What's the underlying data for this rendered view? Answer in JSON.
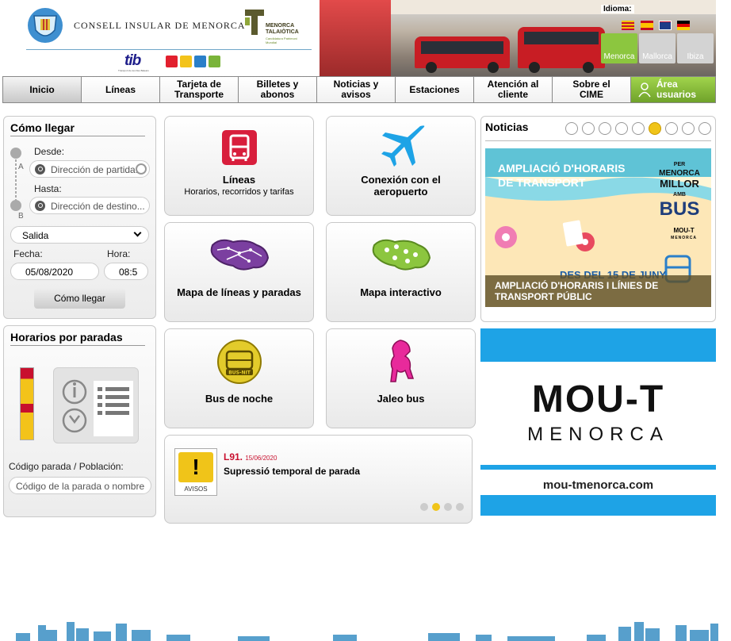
{
  "header": {
    "consell_name": "CONSELL INSULAR DE MENORCA",
    "talaiotica_line1": "MENORCA",
    "talaiotica_line2": "TALAIÒTICA",
    "talaiotica_tagline": "Candidatura Patrimoni Mundial",
    "tib_logo": "tib",
    "tib_tagline": "Transport de les Illes Balears",
    "language_label": "Idioma:",
    "flags": [
      "catalan-flag",
      "spanish-flag",
      "uk-flag",
      "german-flag"
    ],
    "islands": [
      {
        "label": "Menorca",
        "active": true
      },
      {
        "label": "Mallorca",
        "active": false
      },
      {
        "label": "Ibiza",
        "active": false
      }
    ]
  },
  "nav": {
    "items": [
      {
        "label": "Inicio"
      },
      {
        "label": "Líneas"
      },
      {
        "label": "Tarjeta de Transporte"
      },
      {
        "label": "Billetes y abonos"
      },
      {
        "label": "Noticias y avisos"
      },
      {
        "label": "Estaciones"
      },
      {
        "label": "Atención al cliente"
      },
      {
        "label": "Sobre el CIME"
      },
      {
        "label": "Área usuarios"
      }
    ]
  },
  "como_llegar": {
    "title": "Cómo llegar",
    "from_label": "Desde:",
    "from_placeholder": "Dirección de partida...",
    "to_label": "Hasta:",
    "to_placeholder": "Dirección de destino...",
    "marker_a": "A",
    "marker_b": "B",
    "mode_value": "Salida",
    "date_label": "Fecha:",
    "date_value": "05/08/2020",
    "time_label": "Hora:",
    "time_value": "08:5",
    "submit_label": "Cómo llegar"
  },
  "horarios": {
    "title": "Horarios por paradas",
    "stop_label": "Código parada / Población:",
    "stop_placeholder": "Código de la parada o nombre"
  },
  "tiles": {
    "lineas": {
      "title": "Líneas",
      "subtitle": "Horarios, recorridos y tarifas"
    },
    "aeropuerto": {
      "title": "Conexión con el aeropuerto"
    },
    "mapa_lineas": {
      "title": "Mapa de líneas y paradas"
    },
    "mapa_interactivo": {
      "title": "Mapa interactivo"
    },
    "bus_noche": {
      "title": "Bus de noche",
      "badge": "BUS-NIT"
    },
    "jaleo": {
      "title": "Jaleo bus"
    }
  },
  "avisos": {
    "icon_label": "AVISOS",
    "line": "L91.",
    "date": "15/06/2020",
    "text": "Supressió temporal de parada",
    "pages": 4,
    "active_page": 2
  },
  "noticias": {
    "title": "Noticias",
    "dots": 9,
    "active_dot": 6,
    "banner_title_line1": "AMPLIACIÓ D'HORARIS",
    "banner_title_line2": "DE TRANSPORT",
    "banner_slogan_1": "PER",
    "banner_slogan_2": "MENORCA",
    "banner_slogan_3": "MILLOR",
    "banner_slogan_4": "AMB",
    "banner_slogan_5": "BUS",
    "banner_mini_logo": "MOU-T",
    "banner_mini_logo_sub": "MENORCA",
    "banner_partial": "DES DEL 15 DE JUNY",
    "caption": "AMPLIACIÓ D'HORARIS I LÍNIES DE TRANSPORT PÚBLIC"
  },
  "mout_ad": {
    "logo": "MOU-T",
    "sub": "MENORCA",
    "url": "mou-tmenorca.com"
  },
  "colors": {
    "accent_green": "#8cc63f",
    "nav_border": "#888888",
    "sky_blue": "#1ea3e6",
    "bus_red": "#d81e3c",
    "purple": "#7b3fa0"
  }
}
